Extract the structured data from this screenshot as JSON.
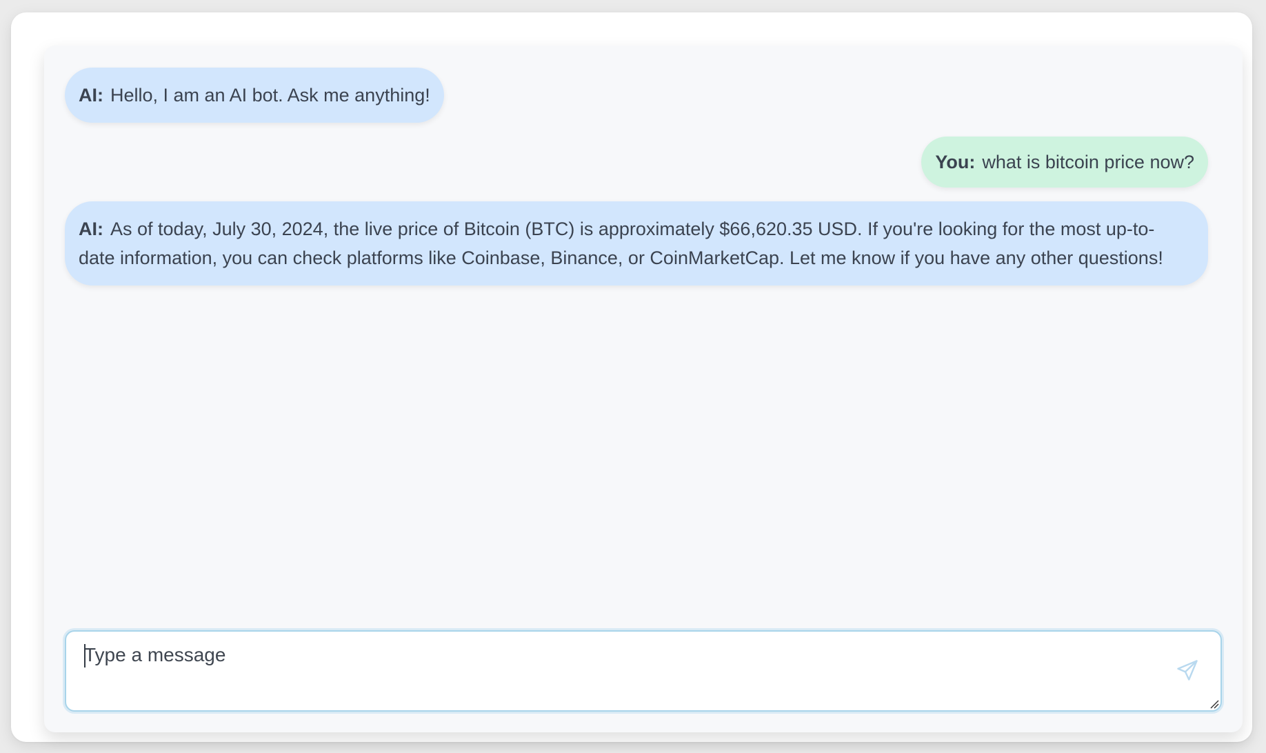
{
  "messages": [
    {
      "role": "ai",
      "speaker": "AI:",
      "text": "Hello, I am an AI bot. Ask me anything!"
    },
    {
      "role": "user",
      "speaker": "You:",
      "text": "what is bitcoin price now?"
    },
    {
      "role": "ai",
      "speaker": "AI:",
      "text": "As of today, July 30, 2024, the live price of Bitcoin (BTC) is approximately $66,620.35 USD. If you're looking for the most up-to-date information, you can check platforms like Coinbase, Binance, or CoinMarketCap. Let me know if you have any other questions!"
    }
  ],
  "composer": {
    "placeholder": "Type a message",
    "value": "",
    "send_icon": "paper-plane-icon"
  },
  "colors": {
    "ai_bubble": "#d2e6fd",
    "user_bubble": "#cef3df",
    "panel_bg": "#f7f8fa",
    "input_border": "#a8d4ea",
    "send_icon": "#b9d9ef"
  }
}
